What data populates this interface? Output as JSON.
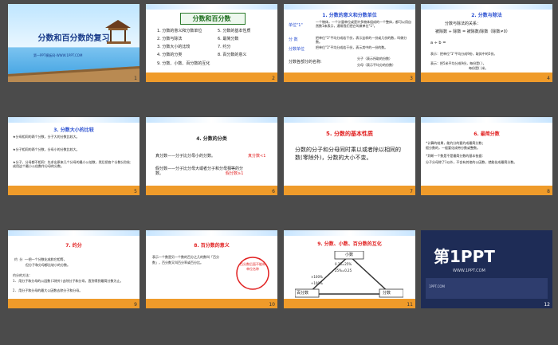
{
  "slides": [
    {
      "number": "1",
      "title": "分数和百分数的复习",
      "site": "第一PPT模板网-WWW.1PPT.COM"
    },
    {
      "number": "2",
      "title": "分数和百分数",
      "items": [
        "1. 分数的意义和分数单位",
        "5. 分数的基本性质",
        "2. 分数与除法",
        "6. 最简分数",
        "3. 分数大小的比较",
        "7. 约分",
        "4. 分数的分类",
        "8. 百分数的意义",
        "9. 分数、小数、百分数的互化"
      ]
    },
    {
      "number": "3",
      "title": "1. 分数的意义和分数单位",
      "lines": [
        "单位\"1\"",
        "一个物体，一个计量单位或是许多物体组成的一个整体，都可以用自然数1来表示，通常我们把它叫做单位\"1\"。",
        "分 数",
        "把单位\"1\"平均分成若干份，表示这样的一份或几份的数，叫做分数。",
        "分数单位",
        "把单位\"1\"平均分成若干份，表示其中的一份的数。",
        "分数各部分的名称:",
        "分子（表示所取的份数）",
        "分母（表示平均分的份数）"
      ]
    },
    {
      "number": "4",
      "title": "2. 分数与除法",
      "lines": [
        "分数与除法的关系：",
        "被除数 ÷ 除数 = 被除数/除数（除数≠0）",
        "a ÷ b =",
        "表示：把单位\"1\"平均分成9份，取其中的5份。",
        "表示：把5米平均分成9份，每份是( )，",
        "每份是( )米。"
      ]
    },
    {
      "number": "5",
      "title": "3. 分数大小的比较",
      "lines": [
        "★分母相同的两个分数，分子大的分数比较大。",
        "★分子相同的两个分数，分母小的分数比较大。",
        "★分子、分母都不相同：先求出原来几个分母的最小公倍数，然后把各个分数分别化成用这个最小公倍数作分母的分数。"
      ]
    },
    {
      "number": "6",
      "title": "4. 分数的分类",
      "lines": [
        "真分数——分子比分母小的分数。",
        "真分数<1",
        "假分数——分子比分母大或者分子和分母相等的分数。",
        "假分数≥1"
      ]
    },
    {
      "number": "7",
      "title": "5. 分数的基本性质",
      "body": "分数的分子和分母同时乘以或者除以相同的数(零除外)，分数的大小不变。"
    },
    {
      "number": "8",
      "title": "6. 最简分数",
      "lines": [
        "*计算的结果，能约分的要约成最简分数；",
        "假分数的，一般要化成带分数或整数。",
        "*判断一个数是不是最简分数的基本依据：",
        "分子分母除了1以外，不含有其他的公因数，就能化成最简分数。"
      ]
    },
    {
      "number": "9",
      "title": "7. 约分",
      "lines": [
        "约 分 ——把一个分数化成和它相等，",
        "但分子和分母都比较小的分数。",
        "约分的方法：",
        "1. 用分子和分母的公因数(1除外)去除分子和分母，直到得到最简分数为止。",
        "2. 用分子和分母的最大公因数去除分子和分母。"
      ]
    },
    {
      "number": "10",
      "title": "8. 百分数的意义",
      "body": "表示一个数是另一个数的百分之几的数叫「百分数」，百分数又叫百分率或百分比。",
      "seal": "百分数后面不能带单位名称"
    },
    {
      "number": "11",
      "title": "9. 分数、小数、百分数的互化",
      "lines": [
        "小数",
        "百分数",
        "分数",
        "0.25=25%",
        "25%=0.25",
        "×100%",
        "÷100%"
      ]
    },
    {
      "number": "12",
      "title": "第1PPT",
      "sub": "WWW.1PPT.COM",
      "caption": "1PPT.COM"
    }
  ]
}
